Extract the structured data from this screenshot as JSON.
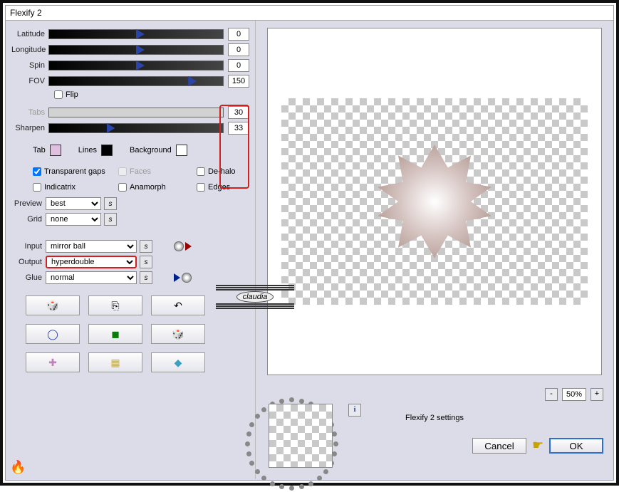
{
  "window": {
    "title": "Flexify 2"
  },
  "sliders": {
    "latitude": {
      "label": "Latitude",
      "value": "0",
      "pos": 50
    },
    "longitude": {
      "label": "Longitude",
      "value": "0",
      "pos": 50
    },
    "spin": {
      "label": "Spin",
      "value": "0",
      "pos": 50
    },
    "fov": {
      "label": "FOV",
      "value": "150",
      "pos": 80
    },
    "tabs": {
      "label": "Tabs",
      "value": "30",
      "disabled": true
    },
    "sharpen": {
      "label": "Sharpen",
      "value": "33",
      "pos": 33
    }
  },
  "flip": {
    "label": "Flip",
    "checked": false
  },
  "swatches": {
    "tab": {
      "label": "Tab",
      "color": "#e0c0e0"
    },
    "lines": {
      "label": "Lines",
      "color": "#000000"
    },
    "bg": {
      "label": "Background",
      "color": "#ffffff"
    }
  },
  "checks": {
    "transparent_gaps": {
      "label": "Transparent gaps",
      "checked": true
    },
    "faces": {
      "label": "Faces",
      "checked": false,
      "disabled": true
    },
    "dehalo": {
      "label": "De-halo",
      "checked": false
    },
    "indicatrix": {
      "label": "Indicatrix",
      "checked": false
    },
    "anamorph": {
      "label": "Anamorph",
      "checked": false
    },
    "edges": {
      "label": "Edges",
      "checked": false
    }
  },
  "selects": {
    "preview": {
      "label": "Preview",
      "value": "best"
    },
    "grid": {
      "label": "Grid",
      "value": "none"
    },
    "input": {
      "label": "Input",
      "value": "mirror ball"
    },
    "output": {
      "label": "Output",
      "value": "hyperdouble"
    },
    "glue": {
      "label": "Glue",
      "value": "normal"
    }
  },
  "zoom": {
    "minus": "-",
    "pct": "50%",
    "plus": "+"
  },
  "caret": "^",
  "info": "i",
  "settings_caption": "Flexify 2 settings",
  "buttons": {
    "cancel": "Cancel",
    "ok": "OK"
  },
  "watermark": "claudia",
  "icons": {
    "random": "🎲",
    "copy": "⎘",
    "undo": "↶",
    "ring": "◯",
    "square": "◼",
    "dice": "🎲",
    "plus": "✚",
    "lego": "▦",
    "gem": "◆"
  }
}
